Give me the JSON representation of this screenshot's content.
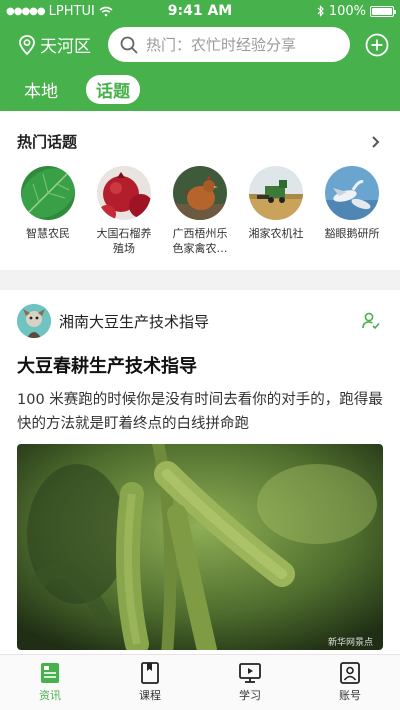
{
  "status_bar": {
    "carrier": "LPHTUI",
    "time": "9:41 AM",
    "battery_percent": "100%"
  },
  "header": {
    "location": "天河区",
    "search_placeholder": "热门：农忙时经验分享",
    "tabs": [
      {
        "label": "本地",
        "active": false
      },
      {
        "label": "话题",
        "active": true
      }
    ]
  },
  "hot_topics": {
    "title": "热门话题",
    "items": [
      {
        "label": "智慧农民",
        "image": "green leaf"
      },
      {
        "label": "大国石榴养殖场",
        "image": "pomegranates"
      },
      {
        "label": "广西梧州乐色家禽农…",
        "image": "hen"
      },
      {
        "label": "湘家农机社",
        "image": "combine harvester in field"
      },
      {
        "label": "豁眼鹅研所",
        "image": "geese"
      }
    ]
  },
  "article": {
    "author": "湘南大豆生产技术指导",
    "title": "大豆春耕生产技术指导",
    "text": "100 米赛跑的时候你是没有时间去看你的对手的，跑得最快的方法就是盯着终点的白线拼命跑",
    "image": "soybean pods on plant",
    "watermark": "新华网景点"
  },
  "bottom_nav": [
    {
      "label": "资讯",
      "icon": "news-icon",
      "active": true
    },
    {
      "label": "课程",
      "icon": "book-icon",
      "active": false
    },
    {
      "label": "学习",
      "icon": "play-screen-icon",
      "active": false
    },
    {
      "label": "账号",
      "icon": "account-icon",
      "active": false
    }
  ],
  "colors": {
    "brand_green": "#47b14c",
    "divider_gray": "#f2f2f2"
  }
}
